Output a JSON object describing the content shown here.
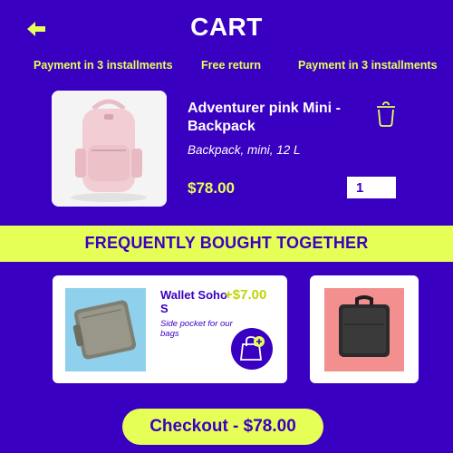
{
  "header": {
    "title": "CART",
    "back_icon": "arrow-left-icon"
  },
  "promos": [
    {
      "label": "Payment in 3 installments"
    },
    {
      "label": "Free return"
    },
    {
      "label": "Payment in 3 installments"
    }
  ],
  "cart_item": {
    "name": "Adventurer pink Mini - Backpack",
    "description": "Backpack, mini, 12 L",
    "price": "$78.00",
    "quantity": "1",
    "image_icon": "pink-backpack-image",
    "remove_icon": "trash-icon"
  },
  "recommendations": {
    "title": "FREQUENTLY BOUGHT TOGETHER",
    "items": [
      {
        "name": "Wallet Soho S",
        "price": "+$7.00",
        "description": "Side pocket for our bags",
        "image_icon": "grey-wallet-image",
        "add_icon": "add-to-bag-icon"
      },
      {
        "image_icon": "black-wallet-image"
      }
    ]
  },
  "checkout": {
    "label": "Checkout - $78.00"
  },
  "colors": {
    "background": "#3a00c2",
    "accent": "#e6ff57",
    "white": "#ffffff"
  }
}
